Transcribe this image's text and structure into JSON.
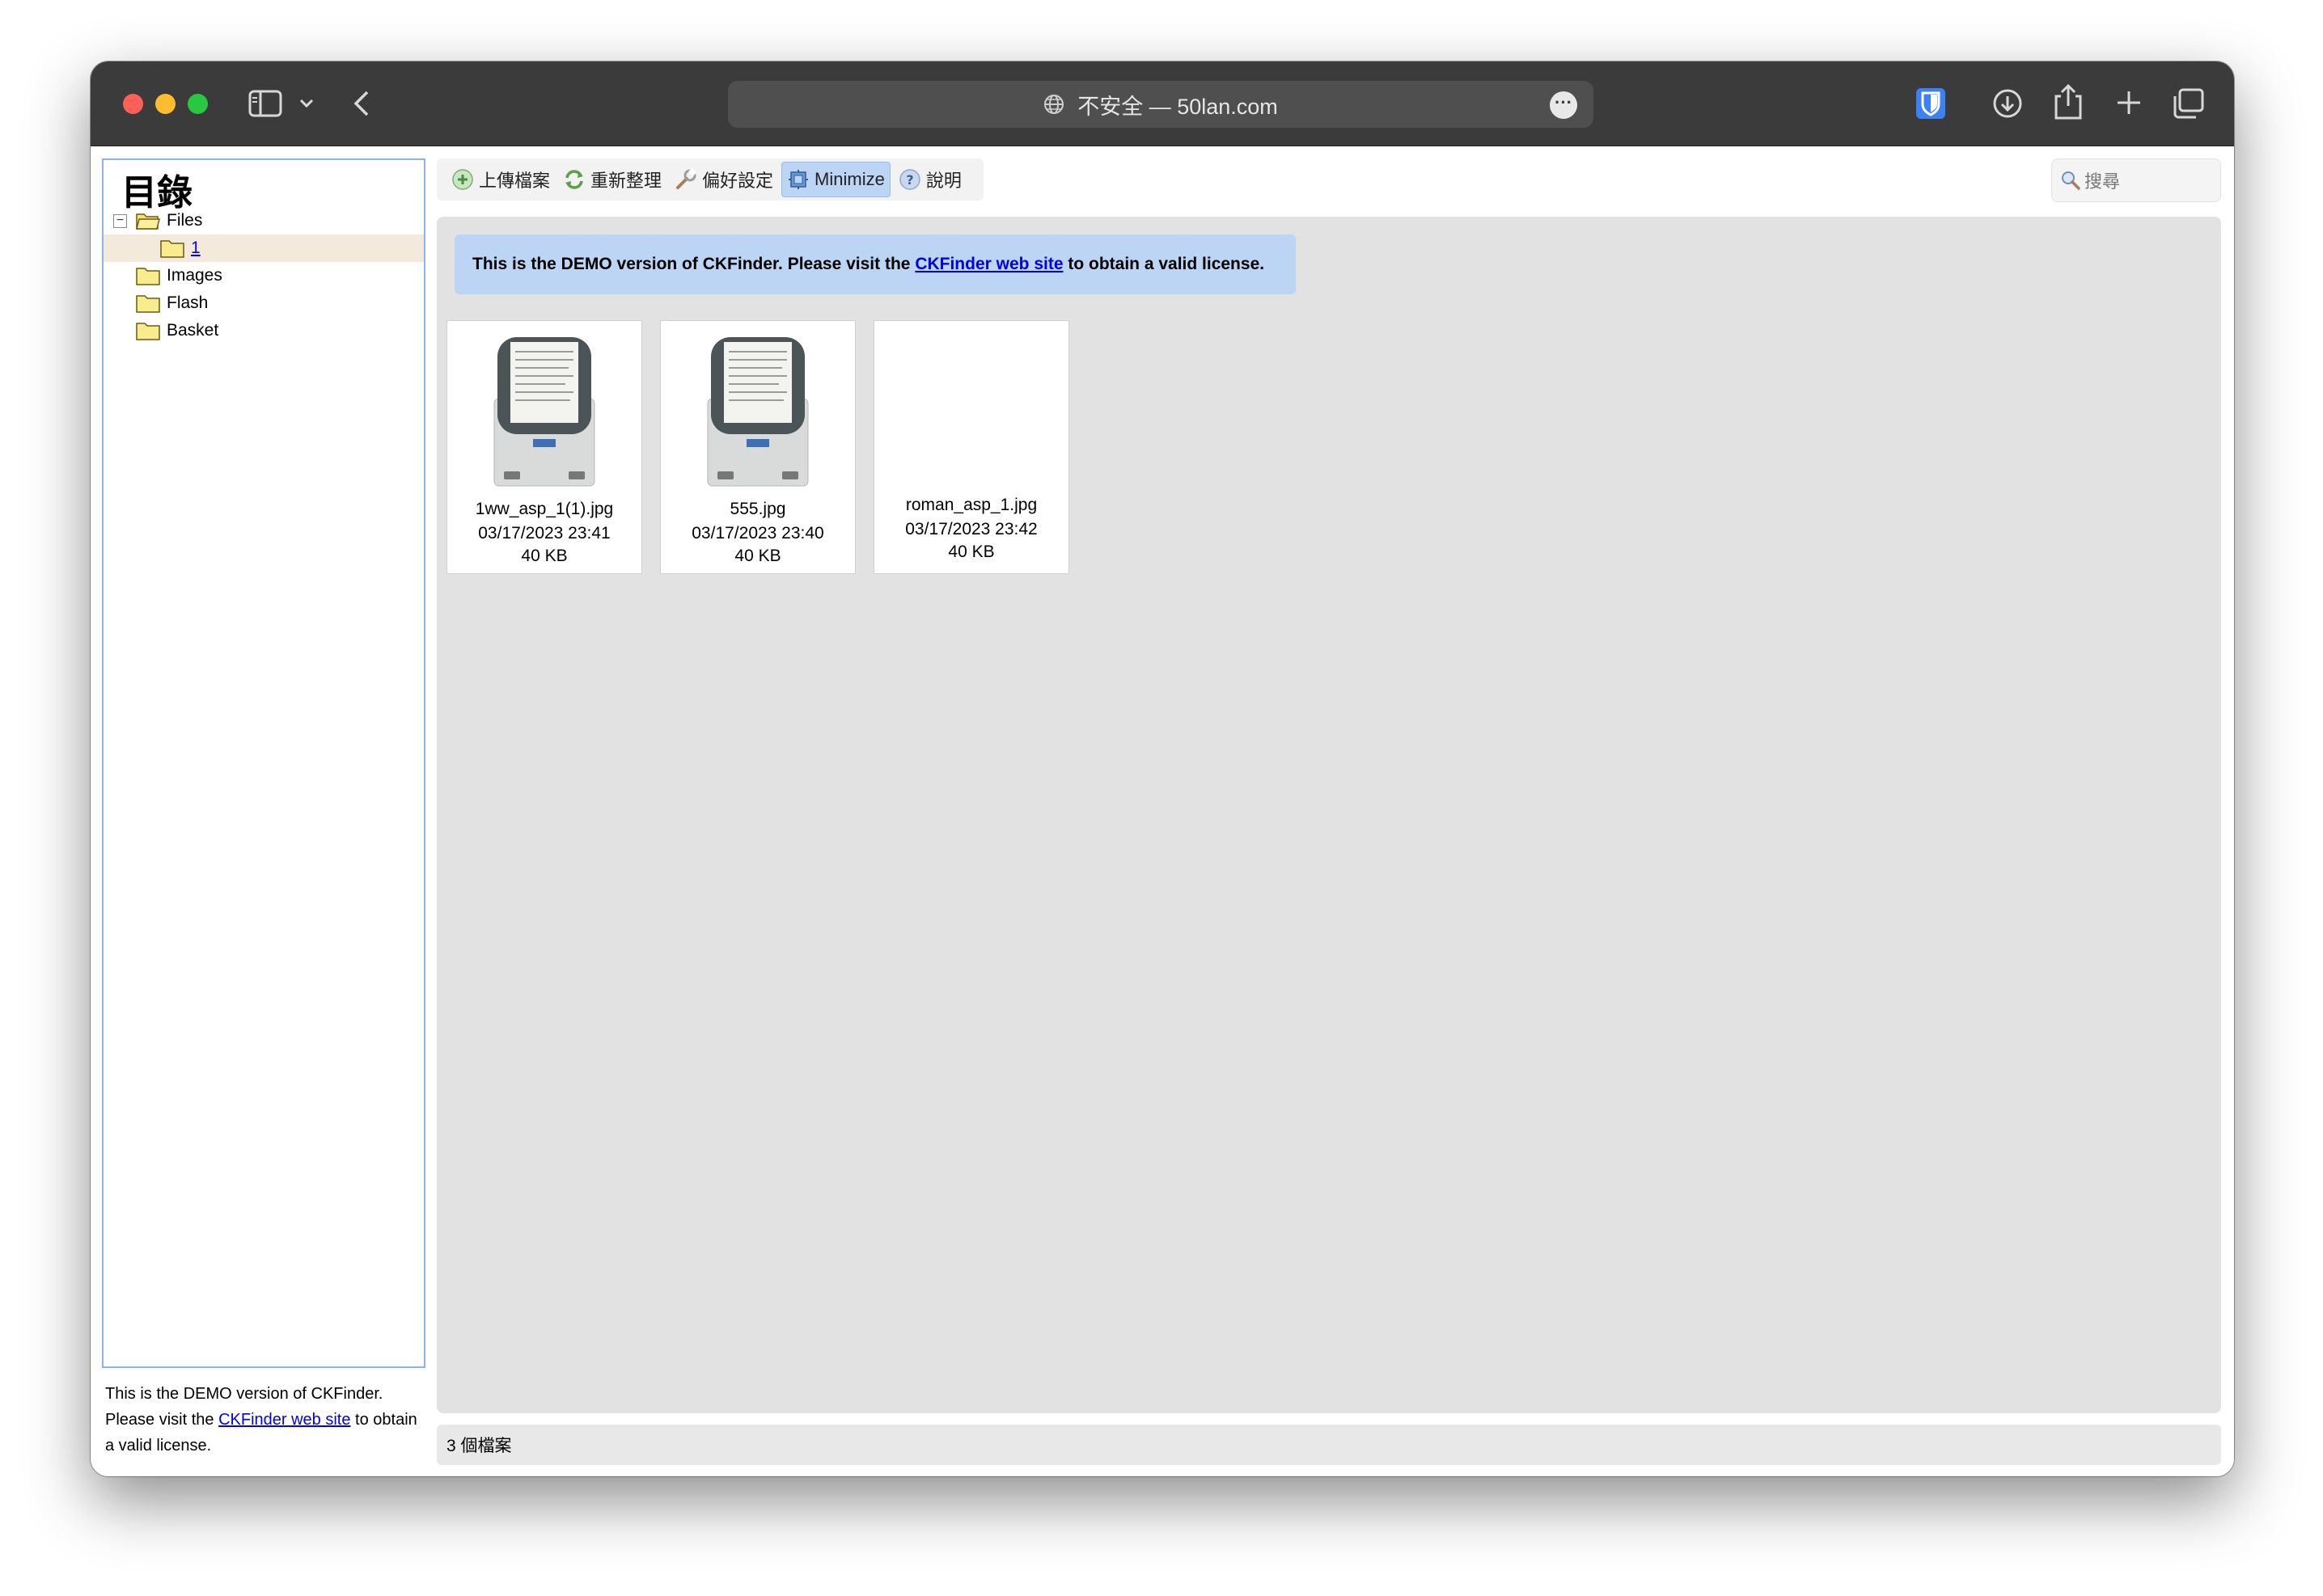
{
  "browser": {
    "url_text": "不安全 — 50lan.com"
  },
  "sidebar": {
    "title": "目錄",
    "tree": [
      {
        "label": "Files",
        "expander": "−"
      },
      {
        "label": "1"
      },
      {
        "label": "Images"
      },
      {
        "label": "Flash"
      },
      {
        "label": "Basket"
      }
    ],
    "demo_notice": {
      "before": "This is the DEMO version of CKFinder. Please visit the ",
      "link": "CKFinder web site",
      "after": " to obtain a valid license."
    }
  },
  "toolbar": {
    "upload": "上傳檔案",
    "refresh": "重新整理",
    "settings": "偏好設定",
    "minimize": "Minimize",
    "help": "說明"
  },
  "search": {
    "placeholder": "搜尋"
  },
  "banner": {
    "before": "This is the DEMO version of CKFinder. Please visit the ",
    "link": "CKFinder web site",
    "after": " to obtain a valid license."
  },
  "files": [
    {
      "name": "1ww_asp_1(1).jpg",
      "date": "03/17/2023 23:41",
      "size": "40 KB",
      "has_thumbnail": true
    },
    {
      "name": "555.jpg",
      "date": "03/17/2023 23:40",
      "size": "40 KB",
      "has_thumbnail": true
    },
    {
      "name": "roman_asp_1.jpg",
      "date": "03/17/2023 23:42",
      "size": "40 KB",
      "has_thumbnail": false
    }
  ],
  "status": {
    "file_count": "3 個檔案"
  }
}
